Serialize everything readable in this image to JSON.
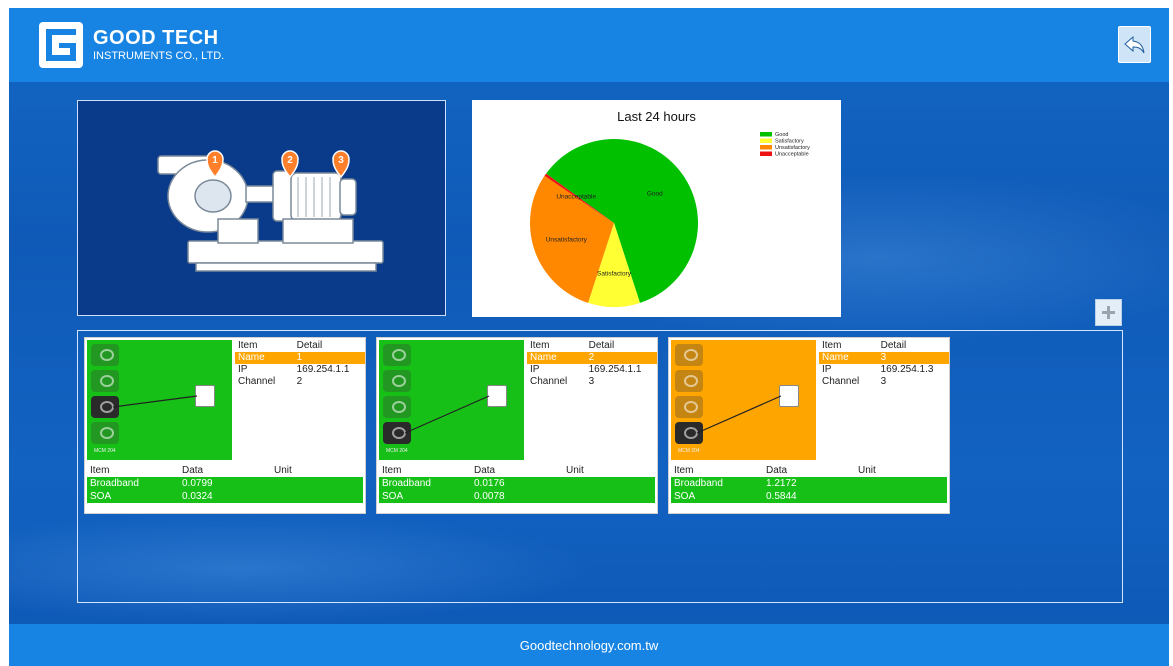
{
  "header": {
    "company_name": "GOOD TECH",
    "company_sub": "INSTRUMENTS CO., LTD.",
    "back_icon": "back-arrow-icon",
    "add_icon": "plus-icon"
  },
  "pump": {
    "markers": [
      "1",
      "2",
      "3"
    ]
  },
  "chart_data": {
    "type": "pie",
    "title": "Last 24 hours",
    "legend_position": "top-right",
    "slices": [
      {
        "label": "Good",
        "value": 60,
        "color": "#00c000"
      },
      {
        "label": "Satisfactory",
        "value": 10,
        "color": "#ffff33"
      },
      {
        "label": "Unsatisfactory",
        "value": 29.5,
        "color": "#ff8800"
      },
      {
        "label": "Unacceptable",
        "value": 0.5,
        "color": "#ee1111"
      }
    ],
    "legend": [
      "Good",
      "Satisfactory",
      "Unsatisfactory",
      "Unacceptable"
    ]
  },
  "cards": [
    {
      "status_color": "#17c017",
      "module_label": "MCM 204",
      "active_connector": 3,
      "detail_header": {
        "item": "Item",
        "detail": "Detail"
      },
      "rows": [
        {
          "item": "Name",
          "detail": "1"
        },
        {
          "item": "IP",
          "detail": "169.254.1.1"
        },
        {
          "item": "Channel",
          "detail": "2"
        }
      ],
      "data_header": {
        "item": "Item",
        "data": "Data",
        "unit": "Unit"
      },
      "data": [
        {
          "item": "Broadband",
          "data": "0.0799",
          "unit": ""
        },
        {
          "item": "SOA",
          "data": "0.0324",
          "unit": ""
        }
      ]
    },
    {
      "status_color": "#17c017",
      "module_label": "MCM 204",
      "active_connector": 4,
      "detail_header": {
        "item": "Item",
        "detail": "Detail"
      },
      "rows": [
        {
          "item": "Name",
          "detail": "2"
        },
        {
          "item": "IP",
          "detail": "169.254.1.1"
        },
        {
          "item": "Channel",
          "detail": "3"
        }
      ],
      "data_header": {
        "item": "Item",
        "data": "Data",
        "unit": "Unit"
      },
      "data": [
        {
          "item": "Broadband",
          "data": "0.0176",
          "unit": ""
        },
        {
          "item": "SOA",
          "data": "0.0078",
          "unit": ""
        }
      ]
    },
    {
      "status_color": "#ffa500",
      "module_label": "MCM 204",
      "active_connector": 4,
      "detail_header": {
        "item": "Item",
        "detail": "Detail"
      },
      "rows": [
        {
          "item": "Name",
          "detail": "3"
        },
        {
          "item": "IP",
          "detail": "169.254.1.3"
        },
        {
          "item": "Channel",
          "detail": "3"
        }
      ],
      "data_header": {
        "item": "Item",
        "data": "Data",
        "unit": "Unit"
      },
      "data": [
        {
          "item": "Broadband",
          "data": "1.2172",
          "unit": ""
        },
        {
          "item": "SOA",
          "data": "0.5844",
          "unit": ""
        }
      ]
    }
  ],
  "footer": {
    "text": "Goodtechnology.com.tw"
  }
}
